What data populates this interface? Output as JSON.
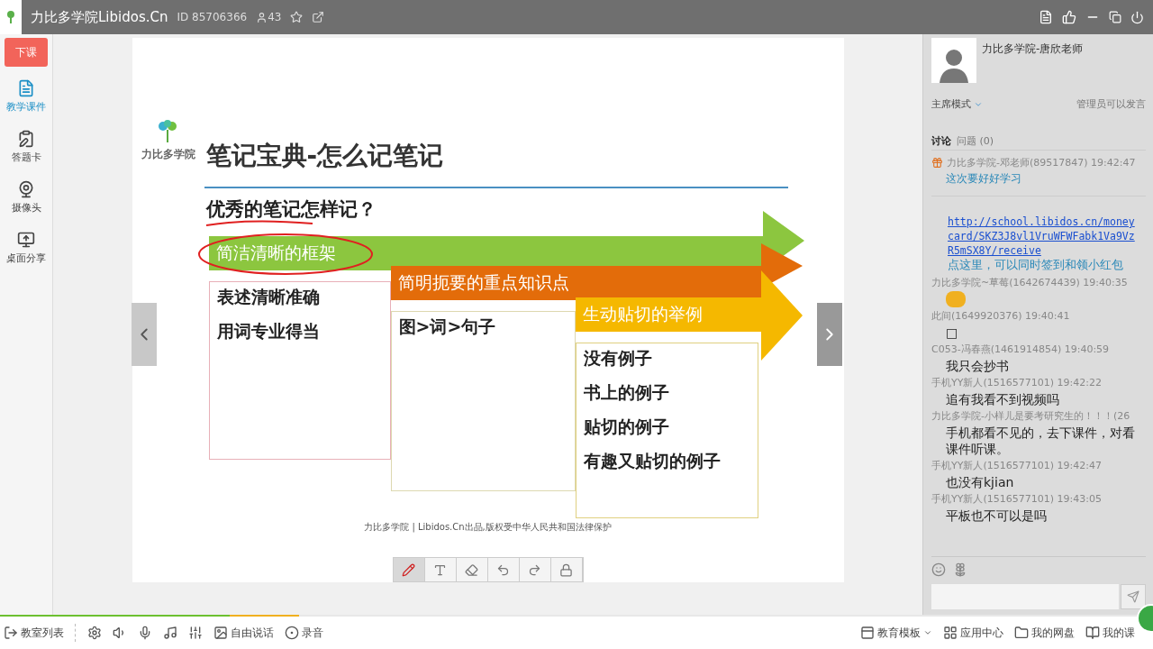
{
  "title_bar": {
    "app_name": "力比多学院Libidos.Cn",
    "room_id": "ID 85706366",
    "online_count": "43"
  },
  "left_rail": {
    "end_button": "下课",
    "items": [
      {
        "label": "教学课件",
        "selected": true
      },
      {
        "label": "答题卡",
        "selected": false
      },
      {
        "label": "摄像头",
        "selected": false
      },
      {
        "label": "桌面分享",
        "selected": false
      }
    ]
  },
  "slide": {
    "logo_text": "力比多学院",
    "title": "笔记宝典-怎么记笔记",
    "question": "优秀的笔记怎样记？",
    "steps": [
      {
        "heading": "简洁清晰的框架",
        "color": "#8cc63f",
        "items": [
          "表述清晰准确",
          "用词专业得当"
        ]
      },
      {
        "heading": "简明扼要的重点知识点",
        "color": "#e36c0a",
        "items": [
          "图>词>句子"
        ]
      },
      {
        "heading": "生动贴切的举例",
        "color": "#f5b800",
        "items": [
          "没有例子",
          "书上的例子",
          "贴切的例子",
          "有趣又贴切的例子"
        ]
      }
    ],
    "footer": "力比多学院 | Libidos.Cn出品,版权受中华人民共和国法律保护"
  },
  "draw_tools": [
    {
      "selected": true
    },
    {
      "selected": false
    },
    {
      "selected": false
    },
    {
      "selected": false
    },
    {
      "selected": false
    },
    {
      "selected": false
    }
  ],
  "side_panel": {
    "teacher": "力比多学院-唐欣老师",
    "mode": "主席模式",
    "speak_rule": "管理员可以发言",
    "tabs": [
      {
        "label": "讨论",
        "selected": true
      },
      {
        "label": "问题",
        "count": "(0)",
        "selected": false
      }
    ],
    "pinned": {
      "sender": "力比多学院-邓老师(89517847) 19:42:47",
      "text": "这次要好好学习"
    },
    "notice": {
      "link": "http://school.libidos.cn/moneycard/SKZ3J8vl1VruWFWFabk1Va9VzR5mSX8Y/receive",
      "text": "点这里，可以同时签到和领小红包"
    },
    "messages": [
      {
        "sender": "力比多学院~草莓(1642674439) 19:40:35",
        "kind": "emoji"
      },
      {
        "sender": "此间(1649920376) 19:40:41",
        "kind": "text",
        "text": "□"
      },
      {
        "sender": "C053-冯春燕(1461914854) 19:40:59",
        "kind": "text",
        "text": "我只会抄书"
      },
      {
        "sender": "手机YY新人(1516577101) 19:42:22",
        "kind": "text",
        "text": "追有我看不到视频吗"
      },
      {
        "sender": "力比多学院-小样儿是要考研究生的！！！(26",
        "kind": "text",
        "text": "手机都看不见的，去下课件，对看课件听课。"
      },
      {
        "sender": "手机YY新人(1516577101) 19:42:47",
        "kind": "text",
        "text": "也没有kjian"
      },
      {
        "sender": "手机YY新人(1516577101) 19:43:05",
        "kind": "text",
        "text": "平板也不可以是吗"
      }
    ]
  },
  "bottom_bar": {
    "left": [
      "教室列表",
      "自由说话",
      "录音"
    ],
    "right": [
      "教育模板",
      "应用中心",
      "我的网盘",
      "我的课"
    ]
  }
}
